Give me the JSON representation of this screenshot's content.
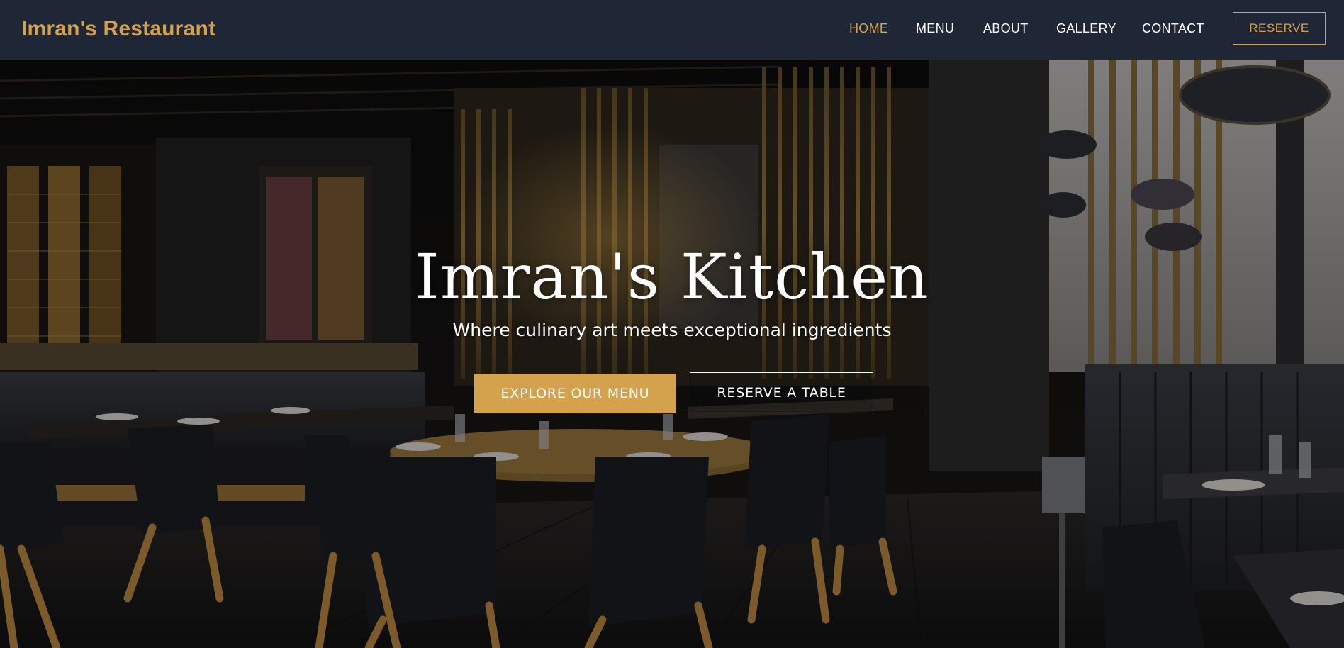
{
  "brand": {
    "name": "Imran's Restaurant"
  },
  "nav": {
    "items": [
      {
        "label": "HOME",
        "active": true
      },
      {
        "label": "MENU",
        "active": false
      },
      {
        "label": "ABOUT",
        "active": false
      },
      {
        "label": "GALLERY",
        "active": false
      },
      {
        "label": "CONTACT",
        "active": false
      }
    ],
    "reserve_label": "RESERVE"
  },
  "hero": {
    "title": "Imran's Kitchen",
    "subtitle": "Where culinary art meets exceptional ingredients",
    "primary_cta": "EXPLORE OUR MENU",
    "secondary_cta": "RESERVE A TABLE"
  },
  "colors": {
    "accent": "#d4a24c",
    "navbar_bg": "#1f2636",
    "text_light": "#ffffff"
  }
}
